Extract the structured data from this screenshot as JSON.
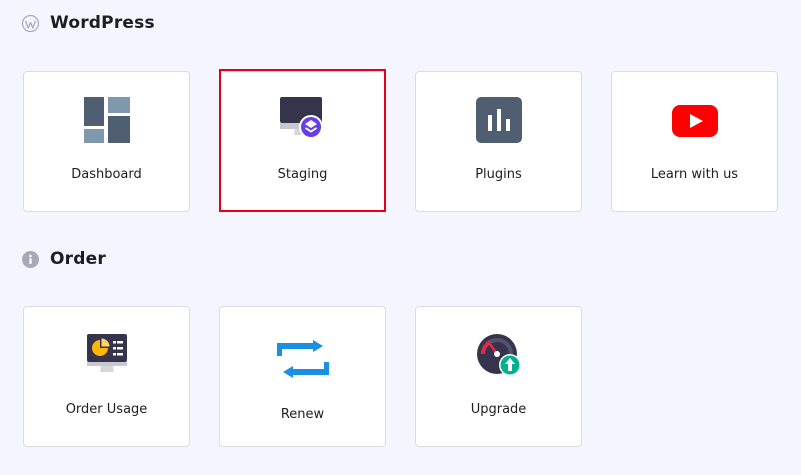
{
  "sections": {
    "wordpress": {
      "title": "WordPress",
      "icon": "wordpress-icon",
      "cards": [
        {
          "label": "Dashboard",
          "icon": "dashboard-grid-icon"
        },
        {
          "label": "Staging",
          "icon": "staging-monitor-icon"
        },
        {
          "label": "Plugins",
          "icon": "plugins-bar-chart-icon"
        },
        {
          "label": "Learn with us",
          "icon": "youtube-play-icon"
        }
      ]
    },
    "order": {
      "title": "Order",
      "icon": "info-icon",
      "cards": [
        {
          "label": "Order Usage",
          "icon": "order-usage-monitor-icon"
        },
        {
          "label": "Renew",
          "icon": "renew-arrows-icon"
        },
        {
          "label": "Upgrade",
          "icon": "upgrade-gauge-icon"
        }
      ]
    }
  },
  "colors": {
    "background": "#f4f5ff",
    "card_border": "#dadce0",
    "highlight": "#e3001b",
    "slate": "#4f5f71",
    "slate_light": "#8098ac",
    "purple": "#673de6",
    "youtube_red": "#ff0000",
    "renew_blue": "#1a8fe3",
    "upgrade_green": "#00b090",
    "gauge_dark": "#36344d",
    "gauge_red": "#e2294a",
    "pie_yellow": "#ffb700"
  }
}
